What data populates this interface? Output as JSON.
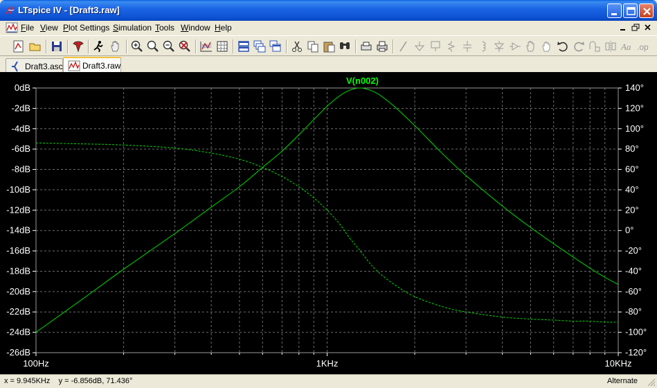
{
  "window": {
    "title": "LTspice IV - [Draft3.raw]",
    "controls": [
      "minimize-icon",
      "maximize-icon",
      "close-icon"
    ]
  },
  "menu": [
    {
      "label": "File",
      "key": "F"
    },
    {
      "label": "View",
      "key": "V"
    },
    {
      "label": "Plot Settings",
      "key": "P"
    },
    {
      "label": "Simulation",
      "key": "S"
    },
    {
      "label": "Tools",
      "key": "T"
    },
    {
      "label": "Window",
      "key": "W"
    },
    {
      "label": "Help",
      "key": "H"
    }
  ],
  "toolbar": {
    "icons": [
      "new-schematic-icon",
      "open-icon",
      "save-icon",
      "control-panel-icon",
      "run-icon",
      "pan-hand-icon",
      "zoom-in-icon",
      "zoom-full-icon",
      "zoom-out-icon",
      "zoom-cancel-icon",
      "autorange-icon",
      "grid-icon",
      "tile-horizontal-icon",
      "cascade-icon",
      "tile-vertical-icon",
      "cut-icon",
      "copy-icon",
      "paste-icon",
      "find-icon",
      "print-preview-icon",
      "print-icon",
      "wire-icon",
      "ground-icon",
      "label-net-icon",
      "resistor-icon",
      "capacitor-icon",
      "inductor-icon",
      "diode-icon",
      "component-icon",
      "move-icon",
      "drag-icon",
      "undo-icon",
      "redo-icon",
      "rotate-icon",
      "mirror-icon",
      "text-icon",
      "spice-directive-icon"
    ]
  },
  "tabs": [
    {
      "label": "Draft3.asc",
      "icon": "schematic-icon",
      "active": false
    },
    {
      "label": "Draft3.raw",
      "icon": "waveform-icon",
      "active": true
    }
  ],
  "chart_data": {
    "type": "line",
    "title": "V(n002)",
    "x_scale": "log",
    "xlim": [
      100,
      10000
    ],
    "x_tick_labels": [
      "100Hz",
      "1KHz",
      "10KHz"
    ],
    "ylim_left": [
      -26,
      0
    ],
    "y_left_tick_labels": [
      "0dB",
      "-2dB",
      "-4dB",
      "-6dB",
      "-8dB",
      "-10dB",
      "-12dB",
      "-14dB",
      "-16dB",
      "-18dB",
      "-20dB",
      "-22dB",
      "-24dB",
      "-26dB"
    ],
    "ylim_right": [
      -120,
      140
    ],
    "y_right_tick_labels": [
      "140°",
      "120°",
      "100°",
      "80°",
      "60°",
      "40°",
      "20°",
      "0°",
      "-20°",
      "-40°",
      "-60°",
      "-80°",
      "-100°",
      "-120°"
    ],
    "grid": true,
    "colors": {
      "background": "#000000",
      "trace": "#00c800",
      "grid": "#6e6e6e",
      "axis_text": "#ffffff",
      "title": "#00ff00"
    },
    "series": [
      {
        "name": "V(n002)",
        "kind": "magnitude",
        "units": "dB",
        "axis": "left",
        "style": "solid",
        "x": [
          100,
          150,
          200,
          300,
          400,
          500,
          600,
          700,
          800,
          900,
          1000,
          1100,
          1200,
          1300,
          1400,
          1500,
          1700,
          2000,
          2500,
          3000,
          4000,
          5000,
          6000,
          7000,
          8000,
          9000,
          10000
        ],
        "y": [
          -24.0,
          -20.4,
          -17.8,
          -14.3,
          -11.7,
          -9.7,
          -7.8,
          -6.2,
          -4.6,
          -3.1,
          -1.8,
          -0.8,
          -0.2,
          0.0,
          -0.2,
          -0.6,
          -1.8,
          -3.7,
          -6.5,
          -8.6,
          -11.6,
          -13.7,
          -15.3,
          -16.6,
          -17.7,
          -18.6,
          -19.3
        ]
      },
      {
        "name": "V(n002)",
        "kind": "phase",
        "units": "deg",
        "axis": "right",
        "style": "dashed",
        "x": [
          100,
          150,
          200,
          300,
          400,
          500,
          600,
          700,
          800,
          900,
          1000,
          1100,
          1200,
          1300,
          1400,
          1500,
          1700,
          2000,
          2500,
          3000,
          4000,
          5000,
          6000,
          7000,
          8000,
          9000,
          10000
        ],
        "y": [
          86,
          85,
          84,
          81,
          76,
          70,
          62,
          53,
          43,
          32,
          20,
          7,
          -8,
          -20,
          -32,
          -41,
          -53,
          -65,
          -75,
          -80,
          -85,
          -87,
          -88,
          -89,
          -89,
          -90,
          -90
        ]
      }
    ]
  },
  "status": {
    "readout": "x = 9.945KHz    y = -6.856dB, 71.436°",
    "mode": "Alternate"
  }
}
